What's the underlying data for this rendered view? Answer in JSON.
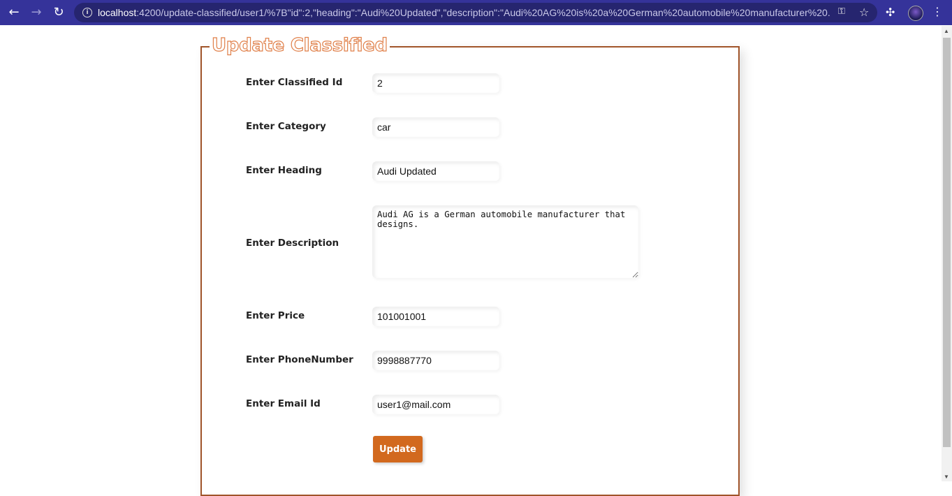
{
  "browser": {
    "url_host": "localhost",
    "url_rest": ":4200/update-classified/user1/%7B\"id\":2,\"heading\":\"Audi%20Updated\",\"description\":\"Audi%20AG%20is%20a%20German%20automobile%20manufacturer%20..."
  },
  "form": {
    "title": "Update Classified",
    "fields": {
      "id": {
        "label": "Enter Classified Id",
        "value": "2"
      },
      "category": {
        "label": "Enter Category",
        "value": "car"
      },
      "heading": {
        "label": "Enter Heading",
        "value": "Audi Updated"
      },
      "description": {
        "label": "Enter Description",
        "value": "Audi AG is a German automobile manufacturer that designs."
      },
      "price": {
        "label": "Enter Price",
        "value": "101001001"
      },
      "phone": {
        "label": "Enter PhoneNumber",
        "value": "9998887770"
      },
      "email": {
        "label": "Enter Email Id",
        "value": "user1@mail.com"
      }
    },
    "submit_label": "Update"
  },
  "colors": {
    "chrome": "#35339a",
    "border": "#a0542a",
    "button": "#d2691e",
    "title_outline": "#e0804a"
  }
}
